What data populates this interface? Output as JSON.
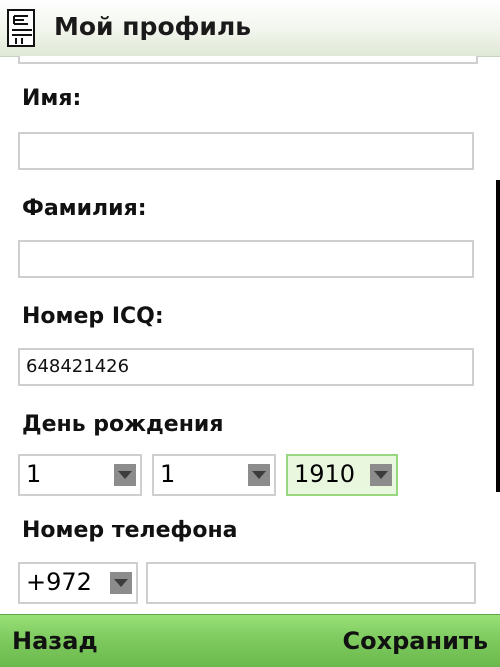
{
  "header": {
    "title": "Мой профиль",
    "icon": "phonebook-app-icon"
  },
  "form": {
    "first_name": {
      "label": "Имя:",
      "value": ""
    },
    "last_name": {
      "label": "Фамилия:",
      "value": ""
    },
    "icq": {
      "label": "Номер ICQ:",
      "value": "648421426"
    },
    "birthday": {
      "label": "День рождения",
      "day": "1",
      "month": "1",
      "year": "1910"
    },
    "phone": {
      "label": "Номер телефона",
      "country_code": "+972",
      "number": ""
    }
  },
  "softkeys": {
    "left": "Назад",
    "right": "Сохранить"
  },
  "colors": {
    "softkey_bar": "#7fcb60",
    "focus_border": "#98d67f",
    "focus_fill": "#e9f7de"
  }
}
